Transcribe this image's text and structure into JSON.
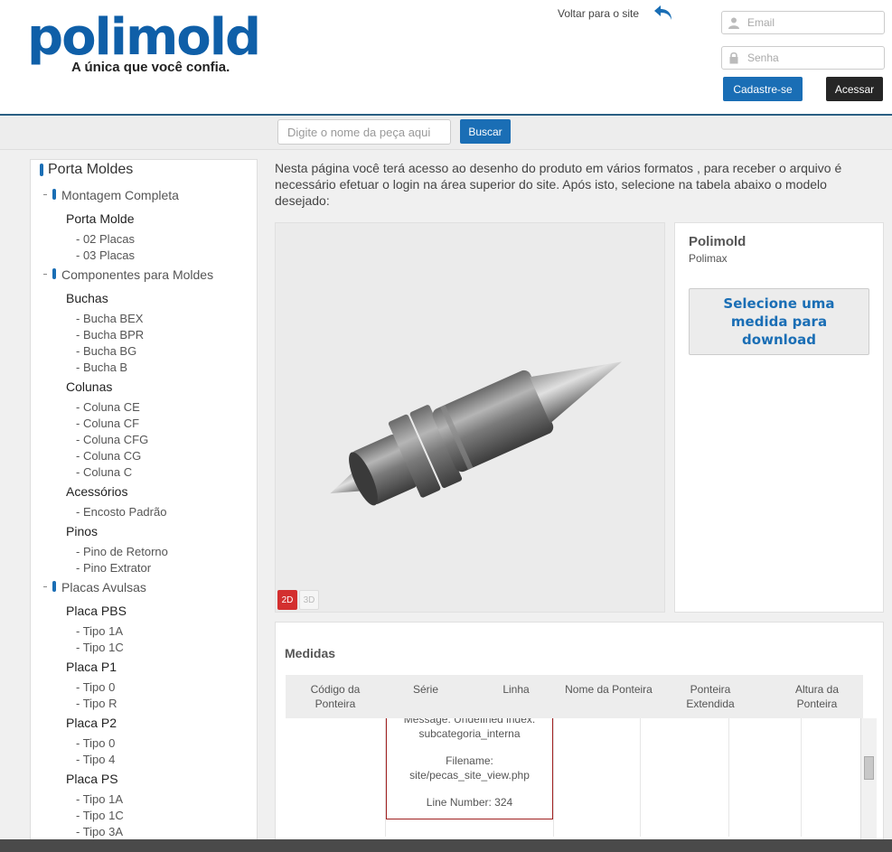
{
  "header": {
    "logo_text": "polimold",
    "logo_tagline": "A única que você confia.",
    "back_link": "Voltar para o site",
    "email_placeholder": "Email",
    "password_placeholder": "Senha",
    "register_label": "Cadastre-se",
    "login_label": "Acessar"
  },
  "search": {
    "placeholder": "Digite o nome da peça aqui",
    "button_label": "Buscar"
  },
  "sidebar": {
    "title": "Porta Moldes",
    "groups": [
      {
        "label": "Montagem Completa",
        "subgroups": [
          {
            "label": "Porta Molde",
            "items": [
              "- 02 Placas",
              "- 03 Placas"
            ]
          }
        ]
      },
      {
        "label": "Componentes para Moldes",
        "subgroups": [
          {
            "label": "Buchas",
            "items": [
              "- Bucha BEX",
              "- Bucha BPR",
              "- Bucha BG",
              "- Bucha B"
            ]
          },
          {
            "label": "Colunas",
            "items": [
              "- Coluna CE",
              "- Coluna CF",
              "- Coluna CFG",
              "- Coluna CG",
              "- Coluna C"
            ]
          },
          {
            "label": "Acessórios",
            "items": [
              "- Encosto Padrão"
            ]
          },
          {
            "label": "Pinos",
            "items": [
              "- Pino de Retorno",
              "- Pino Extrator"
            ]
          }
        ]
      },
      {
        "label": "Placas Avulsas",
        "subgroups": [
          {
            "label": "Placa PBS",
            "items": [
              "- Tipo 1A",
              "- Tipo 1C"
            ]
          },
          {
            "label": "Placa P1",
            "items": [
              "- Tipo 0",
              "- Tipo R"
            ]
          },
          {
            "label": "Placa P2",
            "items": [
              "- Tipo 0",
              "- Tipo 4"
            ]
          },
          {
            "label": "Placa PS",
            "items": [
              "- Tipo 1A",
              "- Tipo 1C",
              "- Tipo 3A"
            ]
          }
        ]
      }
    ]
  },
  "main": {
    "intro": "Nesta página você terá acesso ao desenho do produto em vários formatos , para receber o arquivo é necessário efetuar o login na área superior do site. Após isto, selecione na tabela abaixo o modelo desejado:",
    "toggle_2d": "2D",
    "toggle_3d": "3D",
    "product_title": "Polimold",
    "product_subtitle": "Polimax",
    "select_prompt": "Selecione uma medida para download"
  },
  "medidas": {
    "title": "Medidas",
    "columns": [
      "Código da Ponteira",
      "Série",
      "Linha",
      "Nome da Ponteira",
      "Ponteira Extendida",
      "Altura da Ponteira"
    ],
    "error": {
      "message": "Message: Undefined index: subcategoria_interna",
      "filename": "Filename: site/pecas_site_view.php",
      "line": "Line Number: 324"
    }
  },
  "colors": {
    "brand_blue": "#1a6eb5",
    "logo_blue": "#0f5fa8",
    "active_red": "#d32f2f",
    "dark_button": "#262626"
  }
}
